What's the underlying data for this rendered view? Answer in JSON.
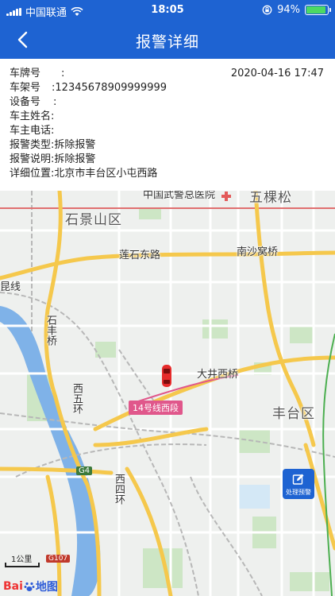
{
  "status_bar": {
    "carrier": "中国联通",
    "time": "18:05",
    "battery_percent": "94%",
    "battery_level": 0.94
  },
  "nav": {
    "title": "报警详细"
  },
  "info": {
    "plate": {
      "label": "车牌号",
      "value": ""
    },
    "frame": {
      "label": "车架号",
      "value": "12345678909999999"
    },
    "device": {
      "label": "设备号",
      "value": ""
    },
    "owner_name": {
      "label": "车主姓名",
      "value": ""
    },
    "owner_phone": {
      "label": "车主电话",
      "value": ""
    },
    "alarm_type": {
      "label": "报警类型",
      "value": "拆除报警"
    },
    "alarm_desc": {
      "label": "报警说明",
      "value": "拆除报警"
    },
    "location": {
      "label": "详细位置",
      "value": "北京市丰台区小屯西路"
    },
    "datetime": "2020-04-16 17:47"
  },
  "map": {
    "labels": {
      "hospital": "中国武警总医院",
      "wukesong": "五棵松",
      "shijingshan": "石景山区",
      "lianshi_east": "莲石东路",
      "nanshawo": "南沙窝桥",
      "line": "昆线",
      "shifeng": "石丰桥",
      "dajing": "大井西桥",
      "xiwuhuan": "西五环",
      "fengtai": "丰台区",
      "xisihuan": "西四环"
    },
    "subway_badge": "14号线西段",
    "highway_badge": "G4",
    "national_road_badge": "G107",
    "scale": "1公里",
    "logo_text": "Bai",
    "logo_suffix": "地图"
  },
  "actions": {
    "handle_alert": "处理预警"
  },
  "colors": {
    "primary": "#1E63D2",
    "road_major": "#F5C84C",
    "water": "#7FB2E8",
    "park": "#CDE6C5"
  }
}
